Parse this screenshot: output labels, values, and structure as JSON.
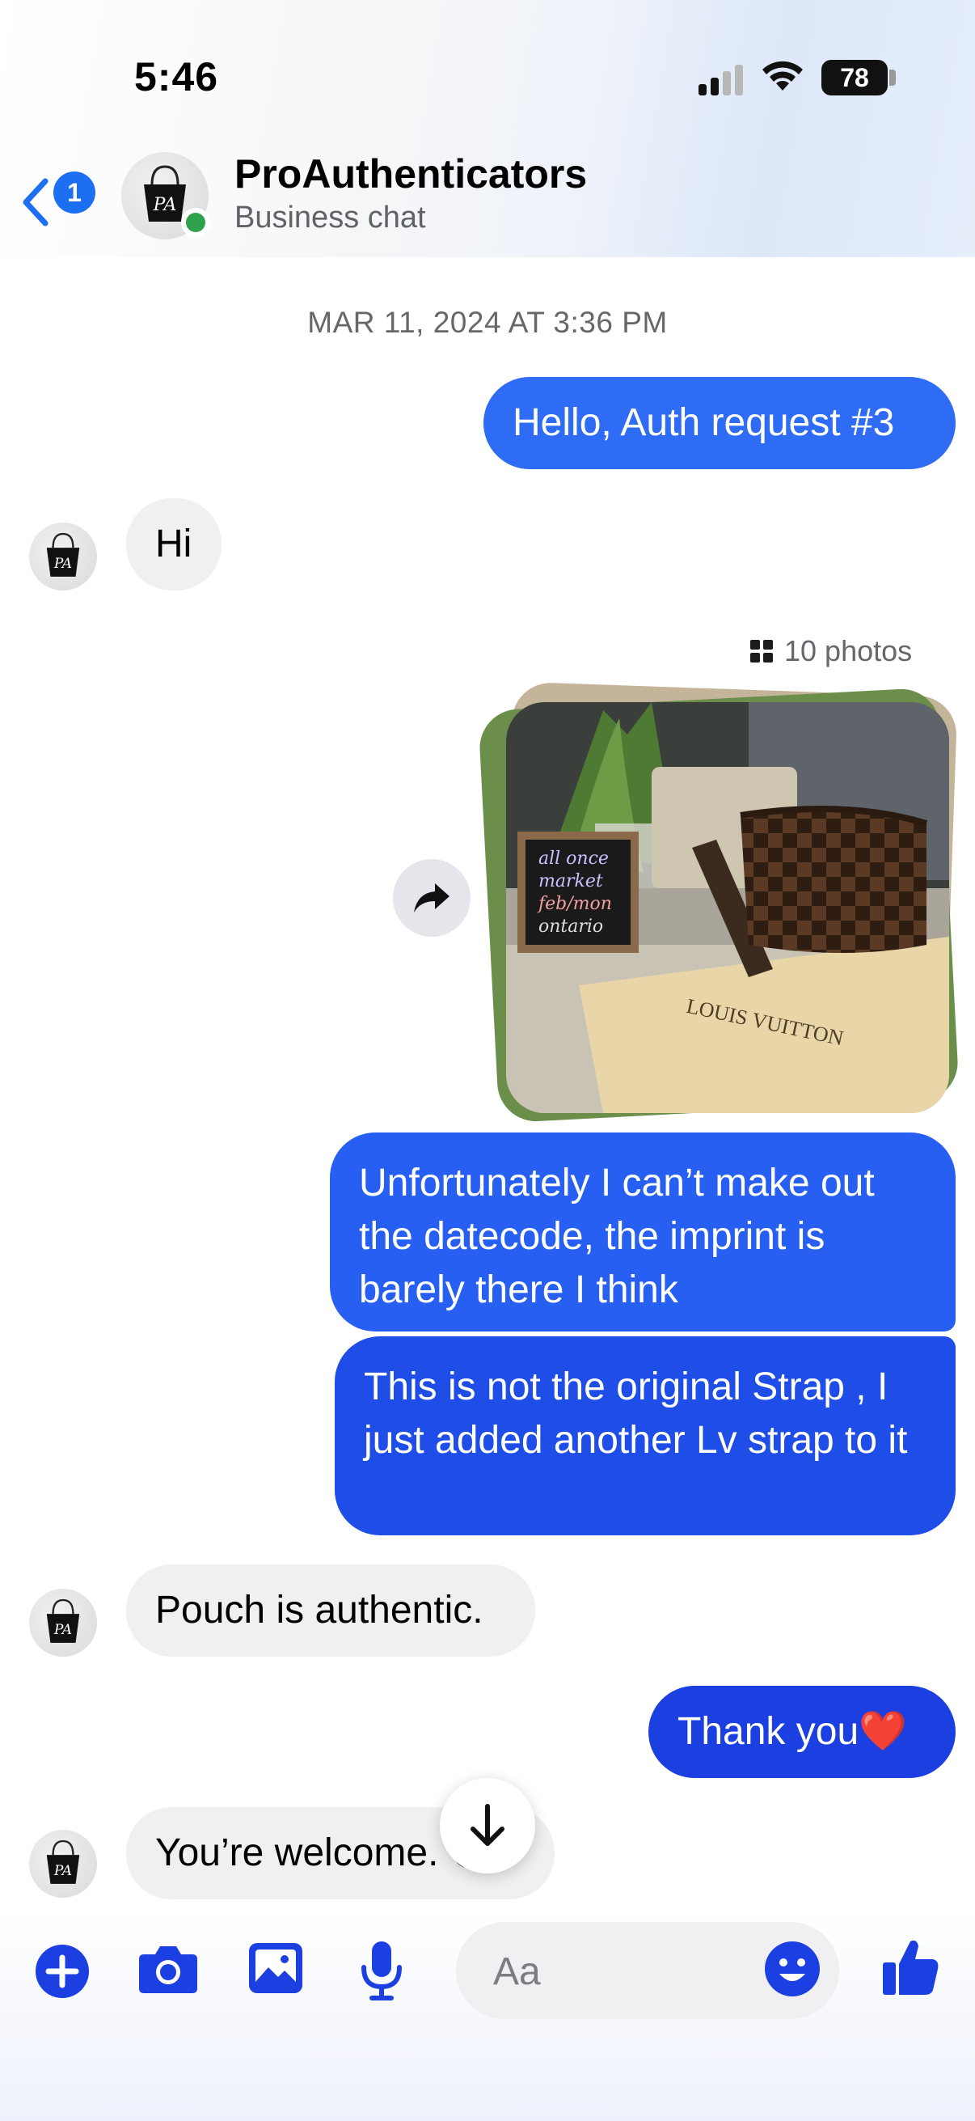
{
  "status_bar": {
    "time": "5:46",
    "battery": "78"
  },
  "header": {
    "back_badge": "1",
    "name": "ProAuthenticators",
    "subtitle": "Business chat",
    "avatar_logo_text": "PA"
  },
  "conversation": {
    "date_stamp": "MAR 11, 2024 AT 3:36 PM",
    "messages": [
      {
        "from": "me",
        "text": "Hello, Auth request #3"
      },
      {
        "from": "them",
        "text": "Hi"
      },
      {
        "from": "me",
        "type": "photos",
        "label": "10 photos"
      },
      {
        "from": "me",
        "text": "Unfortunately I can’t make out the datecode, the imprint is barely there I think"
      },
      {
        "from": "me",
        "text": "This is not the original Strap , I just added another Lv strap to it"
      },
      {
        "from": "them",
        "text": "Pouch is authentic."
      },
      {
        "from": "me",
        "text": "Thank you❤️"
      },
      {
        "from": "them",
        "text": "You’re welcome. 😊"
      }
    ]
  },
  "photo": {
    "chalkboard_text": [
      "all once",
      "market",
      "feb/mon",
      "ontario"
    ],
    "bag_text": "LOUIS VUITTON"
  },
  "composer": {
    "placeholder": "Aa"
  },
  "colors": {
    "accent": "#1d6ff2",
    "bubble_out_1": "#2e6cf6",
    "bubble_out_2": "#1e4de8",
    "bubble_in": "#f0f0f2",
    "online": "#31a24c"
  }
}
